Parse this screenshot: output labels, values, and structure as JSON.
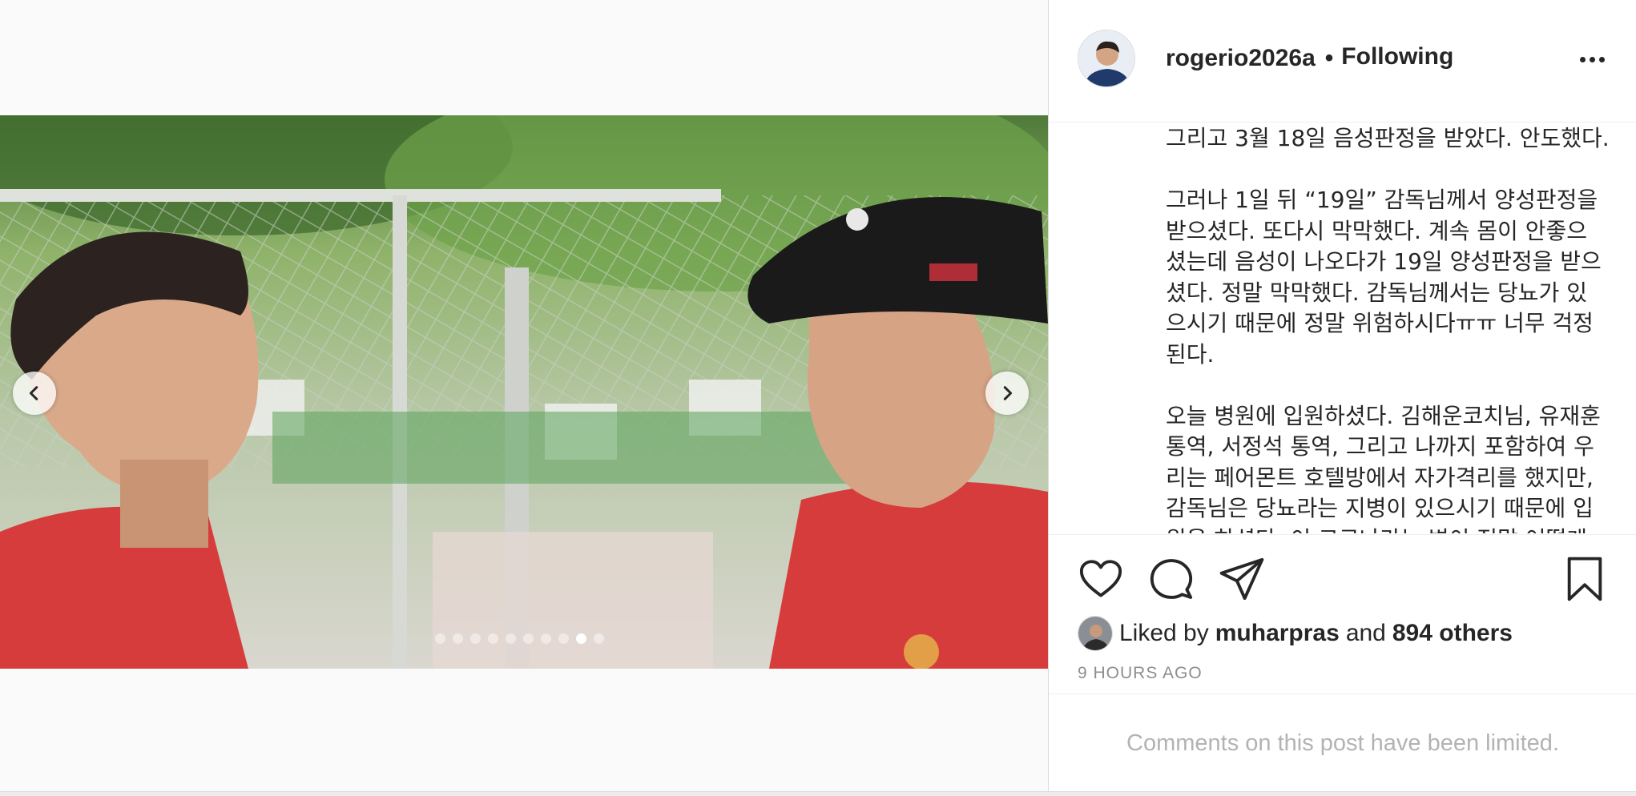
{
  "post": {
    "username": "rogerio2026a",
    "separator": "•",
    "follow_status": "Following",
    "caption": "그리고 3월 18일 음성판정을 받았다. 안도했다.\n\n그러나 1일 뒤 “19일” 감독님께서 양성판정을\n받으셨다. 또다시 막막했다. 계속 몸이 안좋으\n셨는데 음성이 나오다가 19일 양성판정을 받으\n셨다. 정말 막막했다. 감독님께서는 당뇨가 있\n으시기 때문에 정말 위험하시다ㅠㅠ 너무 걱정\n된다.\n\n오늘 병원에 입원하셨다. 김해운코치님, 유재훈\n통역, 서정석 통역, 그리고 나까지 포함하여 우\n리는 페어몬트 호텔방에서 자가격리를 했지만,\n감독님은 당뇨라는 지병이 있으시기 때문에 입\n원을 하셨다. 이 코로나라는 병이 정말 어떻게",
    "likes": {
      "prefix": "Liked by",
      "user": "muharpras",
      "conjunction": "and",
      "others": "894 others"
    },
    "timestamp": "9 HOURS AGO",
    "comments_notice": "Comments on this post have been limited."
  },
  "carousel": {
    "total_slides": 10,
    "active_index": 8
  },
  "icons": {
    "prev": "chevron-left-icon",
    "next": "chevron-right-icon",
    "like": "heart-icon",
    "comment": "comment-bubble-icon",
    "share": "paper-plane-icon",
    "save": "bookmark-icon",
    "more": "more-dots-icon"
  },
  "colors": {
    "text": "#262626",
    "muted": "#8e8e8e",
    "border": "#dbdbdb",
    "jersey_red": "#d83a3a"
  }
}
